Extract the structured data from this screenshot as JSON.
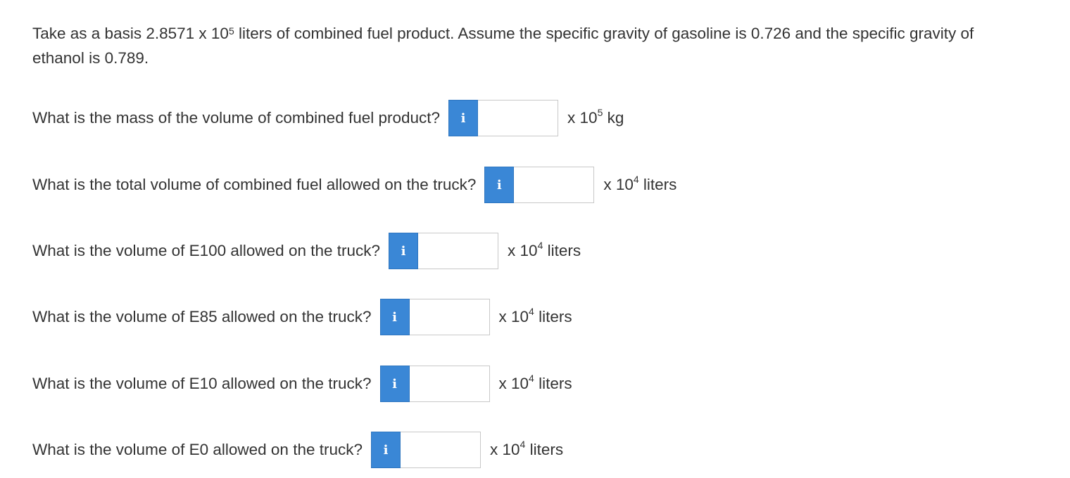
{
  "intro": {
    "part1": "Take as a basis 2.8571 x 10",
    "exp": "5",
    "part2": " liters of combined fuel product. Assume the specific gravity of gasoline is 0.726 and the specific gravity of ethanol is 0.789."
  },
  "info_label": "i",
  "questions": [
    {
      "text": "What is the mass of the volume of combined fuel product?",
      "answer": "",
      "unit_prefix": "x 10",
      "unit_exp": "5",
      "unit_suffix": " kg"
    },
    {
      "text": "What is the total volume of combined fuel allowed on the truck?",
      "answer": "",
      "unit_prefix": "x 10",
      "unit_exp": "4",
      "unit_suffix": " liters"
    },
    {
      "text": "What is the volume of E100 allowed on the truck?",
      "answer": "",
      "unit_prefix": "x 10",
      "unit_exp": "4",
      "unit_suffix": " liters"
    },
    {
      "text": "What is the volume of E85 allowed on the truck?",
      "answer": "",
      "unit_prefix": "x 10",
      "unit_exp": "4",
      "unit_suffix": " liters"
    },
    {
      "text": "What is the volume of E10 allowed on the truck?",
      "answer": "",
      "unit_prefix": "x 10",
      "unit_exp": "4",
      "unit_suffix": " liters"
    },
    {
      "text": "What is the volume of E0 allowed on the truck?",
      "answer": "",
      "unit_prefix": "x 10",
      "unit_exp": "4",
      "unit_suffix": " liters"
    }
  ],
  "colors": {
    "info_button": "#3a87d6",
    "text": "#333333",
    "input_border": "#c8c8c8"
  },
  "icons": {
    "info": "info-icon"
  }
}
